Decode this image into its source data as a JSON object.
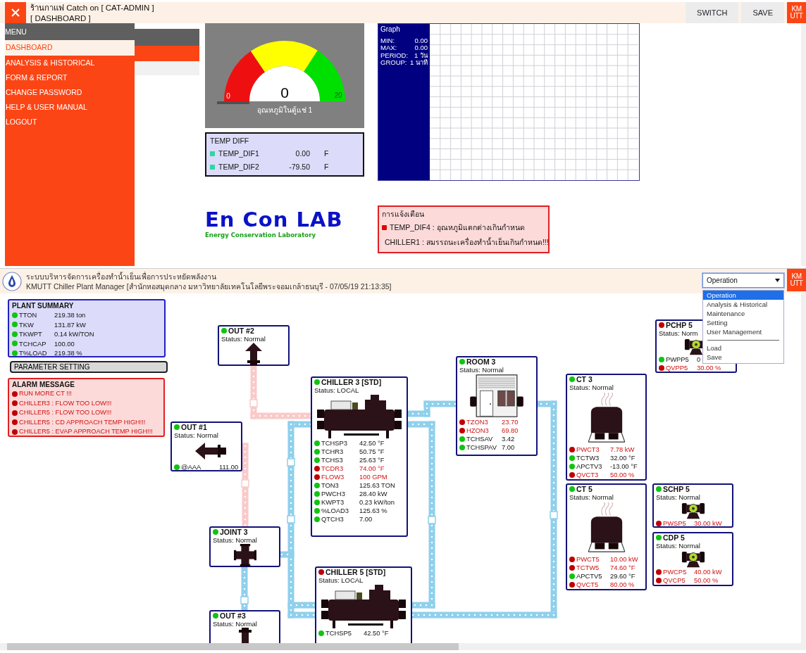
{
  "dashboard": {
    "header": {
      "title": "ร้านกาแฟ Catch on [ CAT-ADMIN ]",
      "subtitle": "[ DASHBOARD ]",
      "buttons": [
        "SWITCH",
        "SAVE"
      ],
      "logo": [
        "KM",
        "UTT"
      ]
    },
    "sidebar": {
      "title": "MENU",
      "items": [
        {
          "label": "DASHBOARD",
          "selected": true
        },
        {
          "label": "ANALYSIS & HISTORICAL",
          "selected": false
        },
        {
          "label": "FORM & REPORT",
          "selected": false
        },
        {
          "label": "CHANGE PASSWORD",
          "selected": false
        },
        {
          "label": "HELP & USER MANUAL",
          "selected": false
        },
        {
          "label": "LOGOUT",
          "selected": false
        }
      ]
    },
    "gauge": {
      "min": "0",
      "max": "20",
      "value": "0",
      "caption": "อุณหภูมิในตู้แช่ 1"
    },
    "temp_diff": {
      "title": "TEMP DIFF",
      "rows": [
        {
          "name": "TEMP_DIF1",
          "value": "0.00",
          "unit": "F"
        },
        {
          "name": "TEMP_DIF2",
          "value": "-79.50",
          "unit": "F"
        }
      ]
    },
    "graph": {
      "title": "Graph",
      "stats": [
        {
          "label": "MIN:",
          "value": "0.00"
        },
        {
          "label": "MAX:",
          "value": "0.00"
        },
        {
          "label": "PERIOD:",
          "value": "1 วัน"
        },
        {
          "label": "GROUP:",
          "value": "1 นาที"
        }
      ]
    },
    "brand": {
      "name": "En Con LAB",
      "tagline": "Energy Conservation Laboratory"
    },
    "alerts": {
      "title": "การแจ้งเตือน",
      "items": [
        "TEMP_DIF4 : อุณหภูมิแตกต่างเกินกำหนด",
        "CHILLER1 : สมรรถนะเครื่องทำน้ำเย็นเกินกำหนด!!!"
      ]
    }
  },
  "plant": {
    "header": {
      "title": "ระบบบริหารจัดการเครื่องทำน้ำเย็นเพื่อการประหยัดพลังงาน",
      "subtitle": "KMUTT Chiller Plant Manager [สำนักหอสมุดกลาง มหาวิทยาลัยเทคโนโลยีพระจอมเกล้าธนบุรี - 07/05/19 21:13:35]",
      "logo": [
        "KM",
        "UTT"
      ]
    },
    "mode_select": {
      "value": "Operation",
      "expanded": true,
      "options": [
        {
          "kind": "item",
          "label": "Operation",
          "selected": true
        },
        {
          "kind": "item",
          "label": "Analysis & Historical",
          "selected": false
        },
        {
          "kind": "item",
          "label": "Maintenance",
          "selected": false
        },
        {
          "kind": "item",
          "label": "Setting",
          "selected": false
        },
        {
          "kind": "item",
          "label": "User Management",
          "selected": false
        },
        {
          "kind": "divider"
        },
        {
          "kind": "item",
          "label": "Load",
          "selected": false
        },
        {
          "kind": "item",
          "label": "Save",
          "selected": false
        }
      ]
    },
    "summary": {
      "title": "PLANT SUMMARY",
      "rows": [
        {
          "name": "TTON",
          "value": "219.38 ton",
          "alarm": false
        },
        {
          "name": "TKW",
          "value": "131.87 kW",
          "alarm": false
        },
        {
          "name": "TKWPT",
          "value": "0.14 kW/TON",
          "alarm": false
        },
        {
          "name": "TCHCAP",
          "value": "100.00",
          "alarm": false
        },
        {
          "name": "T%LOAD",
          "value": "219.38 %",
          "alarm": false
        }
      ]
    },
    "parameter_button": "PARAMETER SETTING",
    "alarm": {
      "title": "ALARM MESSAGE",
      "items": [
        "RUN MORE CT !!!",
        "CHILLER3 : FLOW TOO LOW!!!",
        "CHILLER5 : FLOW TOO LOW!!!",
        "CHILLER5 : CD APPROACH TEMP HIGH!!!",
        "CHILLER5 : EVAP APPROACH TEMP HIGH!!!"
      ]
    },
    "nodes": [
      {
        "kind": "outlet_up",
        "title": "OUT #2",
        "status": "Status: Normal",
        "alarm": false
      },
      {
        "kind": "outlet_left",
        "title": "OUT #1",
        "status": "Status: Normal",
        "alarm": false,
        "points": [
          {
            "name": "@AAA",
            "value": "111.00",
            "alarm": false
          }
        ]
      },
      {
        "kind": "chiller",
        "title": "CHILLER 3 [STD]",
        "status": "Status: LOCAL",
        "alarm": false,
        "points": [
          {
            "name": "TCHSP3",
            "value": "42.50 °F",
            "alarm": false
          },
          {
            "name": "TCHR3",
            "value": "50.75 °F",
            "alarm": false
          },
          {
            "name": "TCHS3",
            "value": "25.63 °F",
            "alarm": false
          },
          {
            "name": "TCDR3",
            "value": "74.00 °F",
            "alarm": true
          },
          {
            "name": "FLOW3",
            "value": "100 GPM",
            "alarm": true
          },
          {
            "name": "TON3",
            "value": "125.63 TON",
            "alarm": false
          },
          {
            "name": "PWCH3",
            "value": "28.40 kW",
            "alarm": false
          },
          {
            "name": "KWPT3",
            "value": "0.23 kW/ton",
            "alarm": false
          },
          {
            "name": "%LOAD3",
            "value": "125.63 %",
            "alarm": false
          },
          {
            "name": "QTCH3",
            "value": "7.00",
            "alarm": false
          }
        ]
      },
      {
        "kind": "room",
        "title": "ROOM 3",
        "status": "Status: Normal",
        "alarm": false,
        "points": [
          {
            "name": "TZON3",
            "value": "23.70",
            "alarm": true
          },
          {
            "name": "HZON3",
            "value": "69.80",
            "alarm": true
          },
          {
            "name": "TCHSAV",
            "value": "3.42",
            "alarm": false
          },
          {
            "name": "TCHSPAV",
            "value": "7.00",
            "alarm": false
          }
        ]
      },
      {
        "kind": "tower",
        "title": "CT 3",
        "status": "Status: Normal",
        "alarm": false,
        "points": [
          {
            "name": "PWCT3",
            "value": "7.78 kW",
            "alarm": true
          },
          {
            "name": "TCTW3",
            "value": "32.00 °F",
            "alarm": false
          },
          {
            "name": "APCTV3",
            "value": "-13.00 °F",
            "alarm": false
          },
          {
            "name": "QVCT3",
            "value": "50.00 %",
            "alarm": true
          }
        ]
      },
      {
        "kind": "tower",
        "title": "CT 5",
        "status": "Status: Normal",
        "alarm": false,
        "points": [
          {
            "name": "PWCT5",
            "value": "10.00 kW",
            "alarm": true
          },
          {
            "name": "TCTW5",
            "value": "74.60 °F",
            "alarm": true
          },
          {
            "name": "APCTV5",
            "value": "29.60 °F",
            "alarm": false
          },
          {
            "name": "QVCT5",
            "value": "80.00 %",
            "alarm": true
          }
        ]
      },
      {
        "kind": "pump",
        "title": "PCHP 5",
        "status": "Status: Norm",
        "alarm": true,
        "points": [
          {
            "name": "PWPP5",
            "value": "0",
            "alarm": false
          },
          {
            "name": "QVPP5",
            "value": "30.00 %",
            "alarm": true
          }
        ]
      },
      {
        "kind": "pump",
        "title": "SCHP 5",
        "status": "Status: Normal",
        "alarm": false,
        "points": [
          {
            "name": "PWSP5",
            "value": "30.00 kW",
            "alarm": true
          }
        ]
      },
      {
        "kind": "pump",
        "title": "CDP 5",
        "status": "Status: Normal",
        "alarm": false,
        "points": [
          {
            "name": "PWCP5",
            "value": "40.00 kW",
            "alarm": true
          },
          {
            "name": "QVCP5",
            "value": "50.00 %",
            "alarm": true
          }
        ]
      },
      {
        "kind": "joint",
        "title": "JOINT 3",
        "status": "Status: Normal",
        "alarm": false
      },
      {
        "kind": "chiller",
        "title": "CHILLER 5 [STD]",
        "status": "Status: LOCAL",
        "alarm": true,
        "points": [
          {
            "name": "TCHSP5",
            "value": "42.50 °F",
            "alarm": false
          }
        ]
      },
      {
        "kind": "outlet_down",
        "title": "OUT #3",
        "status": "Status: Normal",
        "alarm": false
      }
    ]
  }
}
